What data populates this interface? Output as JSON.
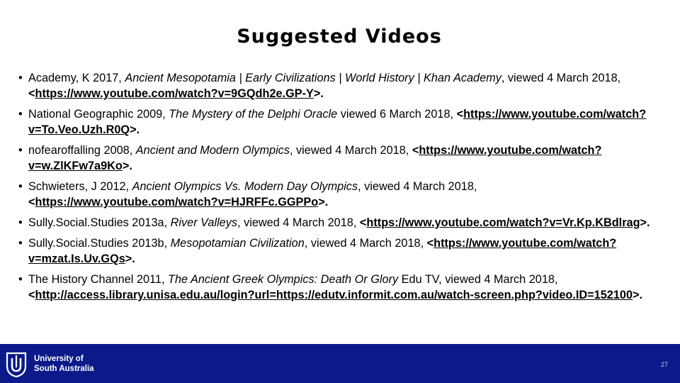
{
  "slide": {
    "title": "Suggested Videos",
    "bullet": "•",
    "references": [
      {
        "author": "Academy, K 2017, ",
        "work": "Ancient Mesopotamia | Early Civilizations | World History | Khan Academy",
        "after": ", viewed 4 March 2018, ",
        "open": "<",
        "url": "https://www.youtube.com/watch?v=9GQdh2e.GP-Y",
        "close": ">."
      },
      {
        "author": "National Geographic 2009, ",
        "work": "The Mystery of the Delphi Oracle",
        "after": "  viewed 6 March 2018, ",
        "open": "<",
        "url": "https://www.youtube.com/watch?v=To.Veo.Uzh.R0Q",
        "close": ">."
      },
      {
        "author": " nofearoffalling 2008, ",
        "work": "Ancient and Modern Olympics",
        "after": ", viewed 4 March  2018, ",
        "open": "<",
        "url": "https://www.youtube.com/watch?v=w.ZlKFw7a9Ko",
        "close": ">."
      },
      {
        "author": " Schwieters, J 2012, ",
        "work": "Ancient Olympics Vs. Modern Day Olympics",
        "after": ", viewed 4 March 2018, ",
        "open": "<",
        "url": "https://www.youtube.com/watch?v=HJRFFc.GGPPo",
        "close": ">."
      },
      {
        "author": " Sully.Social.Studies 2013a, ",
        "work": "River Valleys",
        "after": ", viewed 4 March 2018, ",
        "open": "<",
        "url": "https://www.youtube.com/watch?v=Vr.Kp.KBdlrag",
        "close": ">."
      },
      {
        "author": " Sully.Social.Studies 2013b, ",
        "work": "Mesopotamian Civilization",
        "after": ", viewed 4 March 2018, ",
        "open": "<",
        "url": "https://www.youtube.com/watch?v=mzat.Is.Uv.GQs",
        "close": ">."
      },
      {
        "author": " The History Channel 2011, ",
        "work": "The Ancient Greek Olympics: Death Or Glory",
        "after": "  Edu TV, viewed 4 March 2018, ",
        "open": "<",
        "url": "http://access.library.unisa.edu.au/login?url=https://edutv.informit.com.au/watch-screen.php?video.ID=152100",
        "close": ">."
      }
    ]
  },
  "footer": {
    "logo_line1": "University of",
    "logo_line2": "South Australia",
    "page_number": "27",
    "background_color": "#0b1a88",
    "logo_icon": "unisa-logo-icon"
  }
}
